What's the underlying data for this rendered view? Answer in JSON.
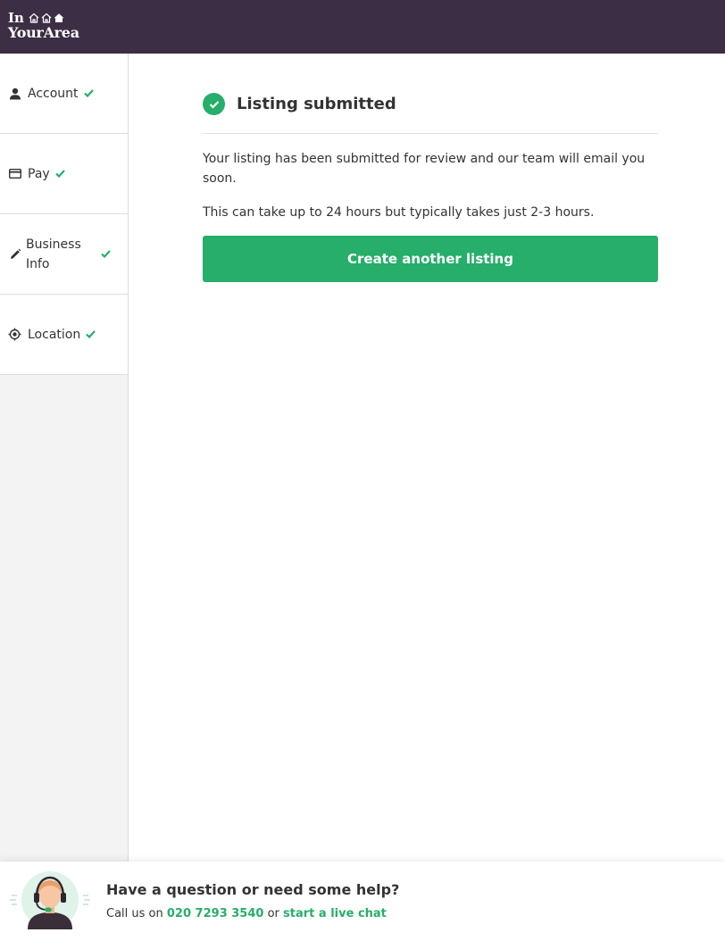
{
  "brand": {
    "line1": "In",
    "line2": "YourArea"
  },
  "sidebar": {
    "items": [
      {
        "label": "Account",
        "icon": "user-icon",
        "done": true
      },
      {
        "label": "Pay",
        "icon": "credit-card-icon",
        "done": true
      },
      {
        "label": "Business Info",
        "icon": "pencil-icon",
        "done": true
      },
      {
        "label": "Location",
        "icon": "target-icon",
        "done": true
      }
    ]
  },
  "main": {
    "title": "Listing submitted",
    "message": "Your listing has been submitted for review and our team will email you soon.",
    "note": "This can take up to 24 hours but typically takes just 2-3 hours.",
    "button_label": "Create another listing"
  },
  "footer": {
    "title": "Have a question or need some help?",
    "prefix": "Call us on",
    "phone": "020 7293 3540",
    "middle": "or",
    "chat_link": "start a live chat"
  },
  "colors": {
    "header_bg": "#3c2f45",
    "accent": "#26ae6a"
  }
}
